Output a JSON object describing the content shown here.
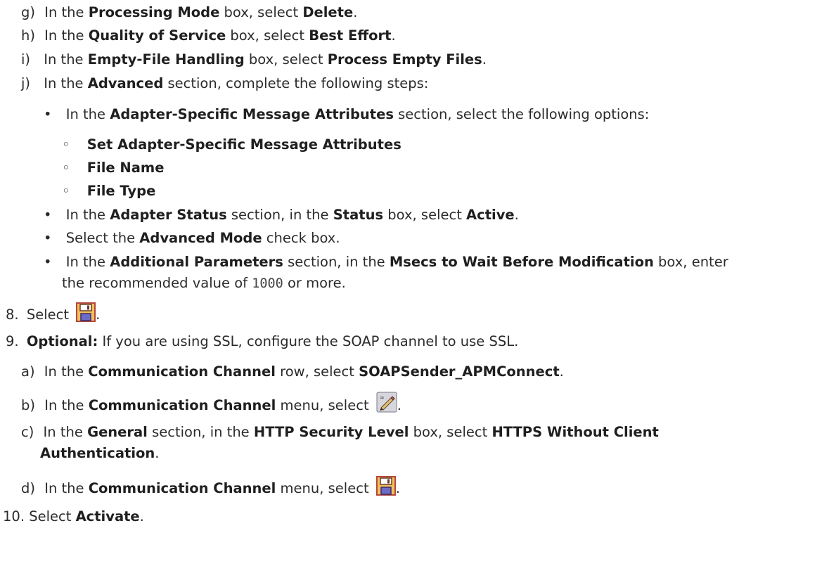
{
  "step7": {
    "g": {
      "marker": "g)",
      "t1": "In the ",
      "b1": "Processing Mode",
      "t2": " box, select ",
      "b2": "Delete",
      "t3": "."
    },
    "h": {
      "marker": "h)",
      "t1": "In the ",
      "b1": "Quality of Service",
      "t2": " box, select ",
      "b2": "Best Effort",
      "t3": "."
    },
    "i": {
      "marker": "i)",
      "t1": "In the ",
      "b1": "Empty-File Handling",
      "t2": " box, select ",
      "b2": "Process Empty Files",
      "t3": "."
    },
    "j": {
      "marker": "j)",
      "t1": "In the ",
      "b1": "Advanced",
      "t2": " section, complete the following steps:"
    },
    "bullets": {
      "one": {
        "t1": "In the ",
        "b1": "Adapter-Specific Message Attributes",
        "t2": " section, select the following options:"
      },
      "sub": [
        "Set Adapter-Specific Message Attributes",
        "File Name",
        "File Type"
      ],
      "two": {
        "t1": "In the ",
        "b1": "Adapter Status",
        "t2": " section, in the ",
        "b2": "Status",
        "t3": " box, select ",
        "b3": "Active",
        "t4": "."
      },
      "three": {
        "t1": "Select the ",
        "b1": "Advanced Mode",
        "t2": " check box."
      },
      "four": {
        "t1": "In the ",
        "b1": "Additional Parameters",
        "t2": " section, in the ",
        "b2": "Msecs to Wait Before Modification",
        "t3": " box, enter",
        "line2a": "the recommended value of ",
        "code": "1000",
        "line2b": " or more."
      }
    }
  },
  "step8": {
    "marker": "8.",
    "t1": "Select ",
    "t2": ".",
    "icon": "save-icon"
  },
  "step9": {
    "marker": "9.",
    "b1": "Optional:",
    "t1": " If you are using SSL, configure the SOAP channel to use SSL.",
    "a": {
      "marker": "a)",
      "t1": "In the ",
      "b1": "Communication Channel",
      "t2": " row, select ",
      "b2": "SOAPSender_APMConnect",
      "t3": "."
    },
    "b": {
      "marker": "b)",
      "t1": "In the ",
      "b1": "Communication Channel",
      "t2": " menu, select ",
      "t3": ".",
      "icon": "edit-pencil-icon"
    },
    "c": {
      "marker": "c)",
      "t1": "In the ",
      "b1": "General",
      "t2": " section, in the ",
      "b2": "HTTP Security Level",
      "t3": " box, select ",
      "b3": "HTTPS Without Client",
      "b4": "Authentication",
      "t4": "."
    },
    "d": {
      "marker": "d)",
      "t1": "In the ",
      "b1": "Communication Channel",
      "t2": " menu, select ",
      "t3": ".",
      "icon": "save-icon"
    }
  },
  "step10": {
    "marker": "10.",
    "t1": "Select ",
    "b1": "Activate",
    "t2": "."
  },
  "bullet_char": "•",
  "sub_bullet_char": "◦",
  "colors": {
    "save_icon_fill": "#f2c25a",
    "save_icon_border": "#b4483c",
    "text": "#2b2b2b"
  }
}
